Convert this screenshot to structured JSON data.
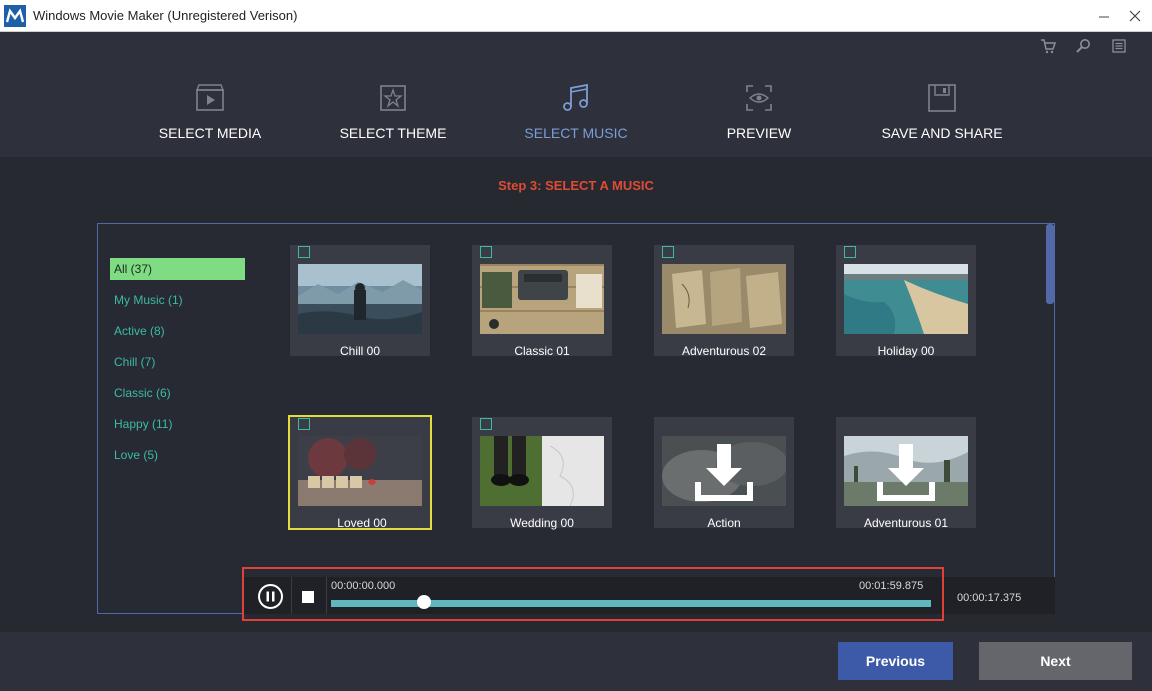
{
  "window": {
    "title": "Windows Movie Maker (Unregistered Verison)"
  },
  "steps": [
    {
      "label": "SELECT MEDIA",
      "icon": "film-icon",
      "active": false
    },
    {
      "label": "SELECT THEME",
      "icon": "theme-star-icon",
      "active": false
    },
    {
      "label": "SELECT MUSIC",
      "icon": "music-note-icon",
      "active": true
    },
    {
      "label": "PREVIEW",
      "icon": "eye-icon",
      "active": false
    },
    {
      "label": "SAVE AND SHARE",
      "icon": "save-icon",
      "active": false
    }
  ],
  "toolbar_icons": [
    "cart-icon",
    "search-icon",
    "menu-list-icon"
  ],
  "step_title": "Step 3: SELECT A MUSIC",
  "categories": [
    {
      "label": "All (37)",
      "active": true
    },
    {
      "label": "My Music (1)",
      "active": false
    },
    {
      "label": "Active (8)",
      "active": false
    },
    {
      "label": "Chill (7)",
      "active": false
    },
    {
      "label": "Classic (6)",
      "active": false
    },
    {
      "label": "Happy (11)",
      "active": false
    },
    {
      "label": "Love (5)",
      "active": false
    }
  ],
  "music_items": [
    {
      "title": "Chill 00",
      "downloadable": false,
      "selected": false
    },
    {
      "title": "Classic 01",
      "downloadable": false,
      "selected": false
    },
    {
      "title": "Adventurous 02",
      "downloadable": false,
      "selected": false
    },
    {
      "title": "Holiday 00",
      "downloadable": false,
      "selected": false
    },
    {
      "title": "Loved 00",
      "downloadable": false,
      "selected": true
    },
    {
      "title": "Wedding 00",
      "downloadable": false,
      "selected": false
    },
    {
      "title": "Action",
      "downloadable": true,
      "selected": false
    },
    {
      "title": "Adventurous 01",
      "downloadable": true,
      "selected": false
    }
  ],
  "player": {
    "current_time": "00:00:00.000",
    "end_time": "00:01:59.875",
    "total_time": "00:00:17.375",
    "progress": 0.155
  },
  "buttons": {
    "previous": "Previous",
    "next": "Next"
  },
  "colors": {
    "active_step": "#7b9dd6",
    "step_title": "#e04b35",
    "category_text": "#3cbba0",
    "category_active_bg": "#7fdc83",
    "selected_border": "#e4dc3a",
    "highlight_frame": "#e0403a",
    "progress_track": "#5fb8bd"
  }
}
